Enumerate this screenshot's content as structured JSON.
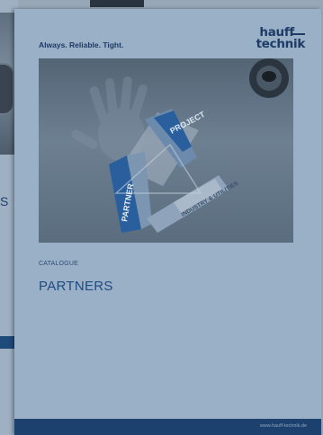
{
  "background": {
    "catalogue_title_fragment": "S"
  },
  "cover": {
    "tagline": "Always. Reliable. Tight.",
    "logo_line1": "hauff",
    "logo_line2": "technik",
    "photo": {
      "segments": [
        "PARTNER",
        "PROJECT",
        "INDUSTRY & UTILITIES"
      ]
    },
    "caption": "CATALOGUE",
    "title": "PARTNERS",
    "footer_url": "www.hauff-technik.de"
  },
  "colors": {
    "brand_blue": "#1d3b66",
    "accent_blue": "#2a5f9e",
    "cover_background": "#9ab0c7",
    "footer_bar": "#1d416e"
  }
}
